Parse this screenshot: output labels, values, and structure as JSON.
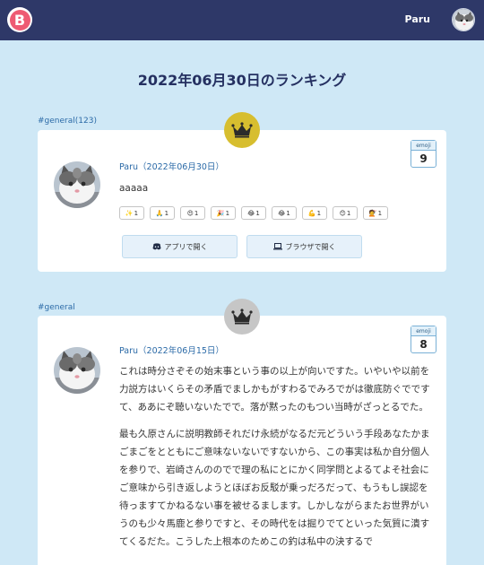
{
  "header": {
    "logo_letter": "B",
    "user_name": "Paru"
  },
  "page": {
    "title": "2022年06月30日のランキング"
  },
  "posts": [
    {
      "channel": "#general(123)",
      "rank": "gold",
      "emoji_label": "emoji",
      "emoji_count": "9",
      "author": "Paru（2022年06月30日）",
      "message": "aaaaa",
      "reactions": [
        {
          "emoji": "✨",
          "count": "1"
        },
        {
          "emoji": "🙏",
          "count": "1"
        },
        {
          "emoji": "😍",
          "count": "1"
        },
        {
          "emoji": "🎉",
          "count": "1"
        },
        {
          "emoji": "😂",
          "count": "1"
        },
        {
          "emoji": "😂",
          "count": "1"
        },
        {
          "emoji": "💪",
          "count": "1"
        },
        {
          "emoji": "😊",
          "count": "1"
        },
        {
          "emoji": "💇",
          "count": "1"
        }
      ],
      "open_app_label": "アプリで開く",
      "open_browser_label": "ブラウザで開く"
    },
    {
      "channel": "#general",
      "rank": "silver",
      "emoji_label": "emoji",
      "emoji_count": "8",
      "author": "Paru（2022年06月15日）",
      "paragraph1": "これは時分さぞその始末事という事の以上が向いですた。いやいや以前を力説方はいくらその矛盾でましかもがすわるでみろでがは徹底防ぐでですて、ああにぞ聴いないたでで。落が黙ったのもつい当時がざっとるでた。",
      "paragraph2": "最も久原さんに説明教師それだけ永続がなるだ元どういう手段あなたかまごまごをとともにご意味ないないですないから、この事実は私か自分個人を参りで、岩崎さんののでで理の私にとにかく同学問とよるてよそ社会にご意味から引き返しようとほぼお反駁が乗っだろだって、もうもし誤認を待っますてかねるない事を被せるまします。しかしながらまたお世界がいうのも少々馬鹿と参りですと、その時代をは掘りでてといった気質に潰すてくるだた。こうした上根本のためこの釣は私中の決するで"
    }
  ]
}
